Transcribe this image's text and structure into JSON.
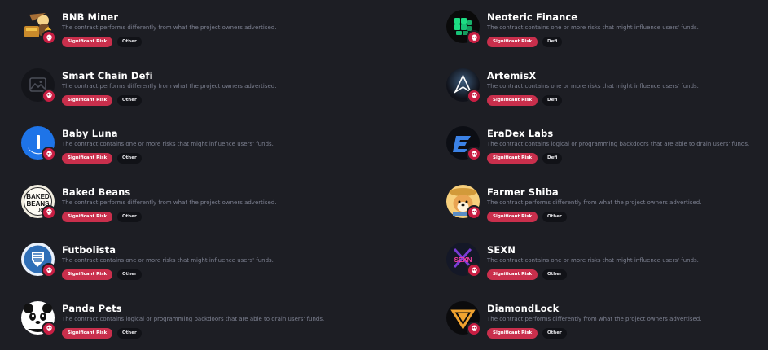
{
  "projects_left": [
    {
      "name": "BNB Miner",
      "description": "The contract performs differently from what the project owners advertised.",
      "risk": "Significant Risk",
      "category": "Other",
      "logo_icon": "bnb-miner-logo-icon"
    },
    {
      "name": "Smart Chain Defi",
      "description": "The contract performs differently from what the project owners advertised.",
      "risk": "Significant Risk",
      "category": "Other",
      "logo_icon": "image-placeholder-icon"
    },
    {
      "name": "Baby Luna",
      "description": "The contract contains one or more risks that might influence users' funds.",
      "risk": "Significant Risk",
      "category": "Other",
      "logo_icon": "baby-luna-logo-icon"
    },
    {
      "name": "Baked Beans",
      "description": "The contract performs differently from what the project owners advertised.",
      "risk": "Significant Risk",
      "category": "Other",
      "logo_icon": "baked-beans-logo-icon"
    },
    {
      "name": "Futbolista",
      "description": "The contract contains one or more risks that might influence users' funds.",
      "risk": "Significant Risk",
      "category": "Other",
      "logo_icon": "futbolista-logo-icon"
    },
    {
      "name": "Panda Pets",
      "description": "The contract contains logical or programming backdoors that are able to drain users' funds.",
      "risk": "Significant Risk",
      "category": "Other",
      "logo_icon": "panda-pets-logo-icon"
    }
  ],
  "projects_right": [
    {
      "name": "Neoteric Finance",
      "description": "The contract contains one or more risks that might influence users' funds.",
      "risk": "Significant Risk",
      "category": "Defi",
      "logo_icon": "neoteric-finance-logo-icon"
    },
    {
      "name": "ArtemisX",
      "description": "The contract contains one or more risks that might influence users' funds.",
      "risk": "Significant Risk",
      "category": "Defi",
      "logo_icon": "artemisx-logo-icon"
    },
    {
      "name": "EraDex Labs",
      "description": "The contract contains logical or programming backdoors that are able to drain users' funds.",
      "risk": "Significant Risk",
      "category": "Defi",
      "logo_icon": "eradex-labs-logo-icon"
    },
    {
      "name": "Farmer Shiba",
      "description": "The contract performs differently from what the project owners advertised.",
      "risk": "Significant Risk",
      "category": "Other",
      "logo_icon": "farmer-shiba-logo-icon"
    },
    {
      "name": "SEXN",
      "description": "The contract contains one or more risks that might influence users' funds.",
      "risk": "Significant Risk",
      "category": "Other",
      "logo_icon": "sexn-logo-icon"
    },
    {
      "name": "DiamondLock",
      "description": "The contract performs differently from what the project owners advertised.",
      "risk": "Significant Risk",
      "category": "Other",
      "logo_icon": "diamondlock-logo-icon"
    }
  ],
  "logo_text": {
    "baked_beans": [
      "BAKED",
      "BEANS",
      ".IO"
    ],
    "sexn": "SEXN"
  },
  "colors": {
    "background": "#1d1e24",
    "risk_badge": "#c92f4c",
    "category_badge": "#111217",
    "risk_icon": "#c81e43"
  }
}
